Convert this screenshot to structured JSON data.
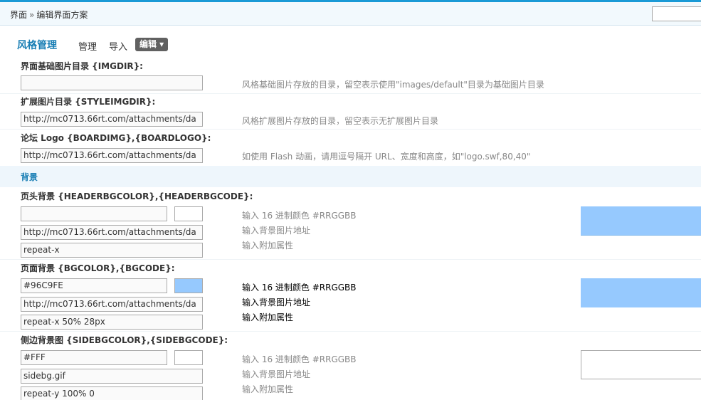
{
  "breadcrumb": {
    "root": "界面",
    "separator": "»",
    "current": "编辑界面方案"
  },
  "nav": {
    "title": "风格管理",
    "tabs": [
      {
        "label": "管理"
      },
      {
        "label": "导入"
      },
      {
        "label": "编辑 ▾"
      }
    ]
  },
  "settings": {
    "imgdir": {
      "label": "界面基础图片目录 {IMGDIR}:",
      "value": "",
      "hint": "风格基础图片存放的目录，留空表示使用\"images/default\"目录为基础图片目录"
    },
    "styleimgdir": {
      "label": "扩展图片目录 {STYLEIMGDIR}:",
      "value": "http://mc0713.66rt.com/attachments/da",
      "hint": "风格扩展图片存放的目录，留空表示无扩展图片目录"
    },
    "boardimg": {
      "label": "论坛 Logo {BOARDIMG},{BOARDLOGO}:",
      "value": "http://mc0713.66rt.com/attachments/da",
      "hint": "如使用 Flash 动画，请用逗号隔开 URL、宽度和高度，如\"logo.swf,80,40\""
    }
  },
  "background_section": {
    "title": "背景",
    "header": {
      "label": "页头背景 {HEADERBGCOLOR},{HEADERBGCODE}:",
      "color": "",
      "image": "http://mc0713.66rt.com/attachments/da",
      "extra": "repeat-x",
      "hint_color": "输入 16 进制颜色 #RRGGBB",
      "hint_image": "输入背景图片地址",
      "hint_extra": "输入附加属性",
      "preview_color": "#96C9FE"
    },
    "page": {
      "label": "页面背景 {BGCOLOR},{BGCODE}:",
      "color": "#96C9FE",
      "image": "http://mc0713.66rt.com/attachments/da",
      "extra": "repeat-x 50% 28px",
      "hint_color": "输入 16 进制颜色 #RRGGBB",
      "hint_image": "输入背景图片地址",
      "hint_extra": "输入附加属性",
      "preview_color": "#96C9FE"
    },
    "sidebar": {
      "label": "侧边背景图 {SIDEBGCOLOR},{SIDEBGCODE}:",
      "color": "#FFF",
      "image": "sidebg.gif",
      "extra": "repeat-y 100% 0",
      "hint_color": "输入 16 进制颜色 #RRGGBB",
      "hint_image": "输入背景图片地址",
      "hint_extra": "输入附加属性",
      "preview_color": "#FFFFFF"
    }
  },
  "colors": {
    "accent": "#1A7FB5",
    "topbar_border": "#1A9AD6",
    "swatch_blue": "#96C9FE"
  }
}
